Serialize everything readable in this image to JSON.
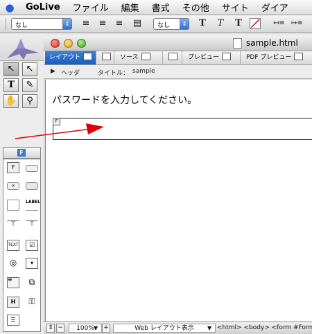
{
  "menubar": {
    "app": "GoLive",
    "items": [
      "ファイル",
      "編集",
      "書式",
      "その他",
      "サイト",
      "ダイア"
    ]
  },
  "toolbar": {
    "paragraph_format": "なし",
    "font_set": "なし"
  },
  "window": {
    "title": "sample.html",
    "tabs": [
      {
        "label": "レイアウト"
      },
      {
        "label": "ソース"
      },
      {
        "label": "プレビュー"
      },
      {
        "label": "PDF プレビュー"
      }
    ],
    "header_label": "ヘッダ",
    "title_label": "タイトル：",
    "title_value": "sample",
    "content_text": "パスワードを入力してください。",
    "form_badge": "F"
  },
  "palette": {
    "tab_label": "F",
    "items": [
      "form",
      "button",
      "reset",
      "text-field",
      "image",
      "label",
      "hidden",
      "password",
      "textarea",
      "checkbox",
      "radio",
      "select",
      "list",
      "file",
      "h",
      "keygen",
      "fieldset",
      "isindex"
    ]
  },
  "statusbar": {
    "zoom": "100%",
    "view_mode": "Web レイアウト表示",
    "breadcrumb": "<html>  <body>  <form #FormN"
  },
  "colors": {
    "selection_blue": "#1b5fbd",
    "arrow_red": "#e00000"
  }
}
